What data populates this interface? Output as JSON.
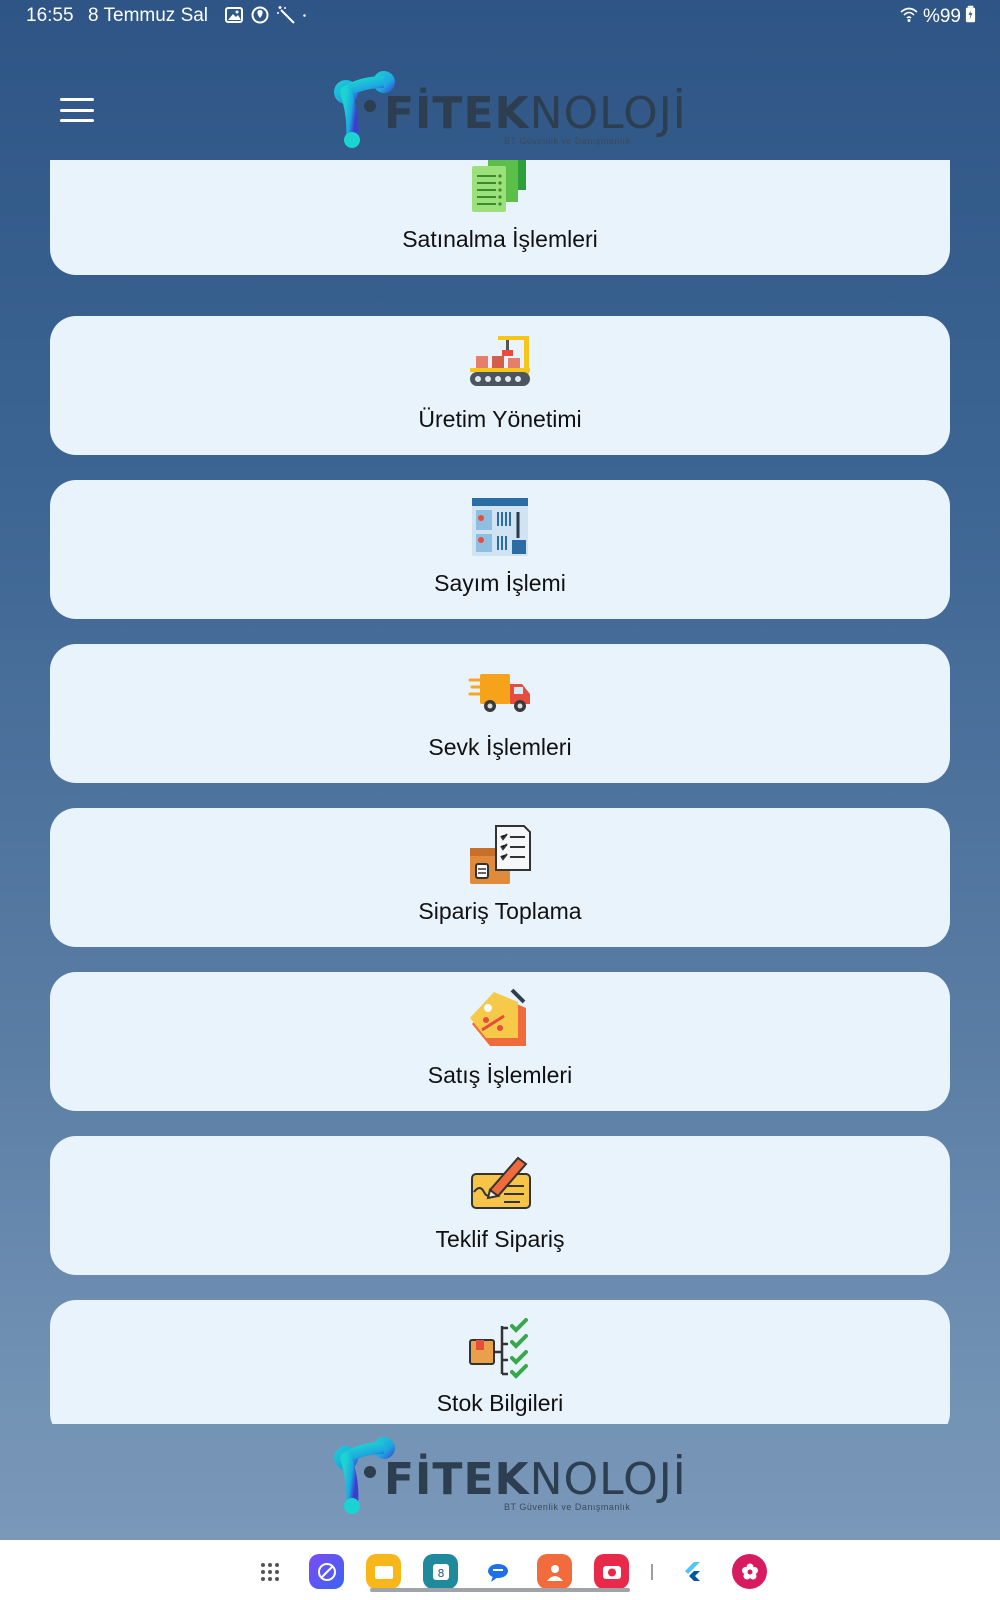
{
  "status_bar": {
    "time": "16:55",
    "date": "8 Temmuz Sal",
    "battery_text": "%99",
    "notification_icons": [
      "gallery-icon",
      "location-sync-icon",
      "magic-wand-icon",
      "dot-icon"
    ]
  },
  "header": {
    "menu_icon": "hamburger-icon",
    "logo": {
      "bold": "FİTEK",
      "light": "NOLOJİ",
      "tagline": "BT Güvenlik ve Danışmanlık"
    }
  },
  "menu": {
    "items": [
      {
        "label": "Satınalma İşlemleri",
        "icon": "purchase-documents-icon"
      },
      {
        "label": "Üretim Yönetimi",
        "icon": "production-line-icon"
      },
      {
        "label": "Sayım İşlemi",
        "icon": "inventory-count-icon"
      },
      {
        "label": "Sevk İşlemleri",
        "icon": "delivery-truck-icon"
      },
      {
        "label": "Sipariş Toplama",
        "icon": "order-picking-icon"
      },
      {
        "label": "Satış İşlemleri",
        "icon": "sale-tag-icon"
      },
      {
        "label": "Teklif Sipariş",
        "icon": "quote-signature-icon"
      },
      {
        "label": "Stok Bilgileri",
        "icon": "stock-checklist-icon"
      }
    ]
  },
  "footer": {
    "logo": {
      "bold": "FİTEK",
      "light": "NOLOJİ",
      "tagline": "BT Güvenlik ve Danışmanlık"
    }
  },
  "dock": {
    "apps": [
      "app-drawer-icon",
      "browser-icon",
      "files-icon",
      "calendar-icon",
      "messages-icon",
      "contacts-icon",
      "camera-icon",
      "flutter-icon",
      "gallery-flower-icon"
    ],
    "calendar_day": "8"
  },
  "colors": {
    "background_top": "#2e5585",
    "background_bottom": "#7d9aba",
    "card": "#e9f3fc",
    "logo_cyan": "#1ec9d8",
    "logo_blue": "#2a7fd4"
  }
}
